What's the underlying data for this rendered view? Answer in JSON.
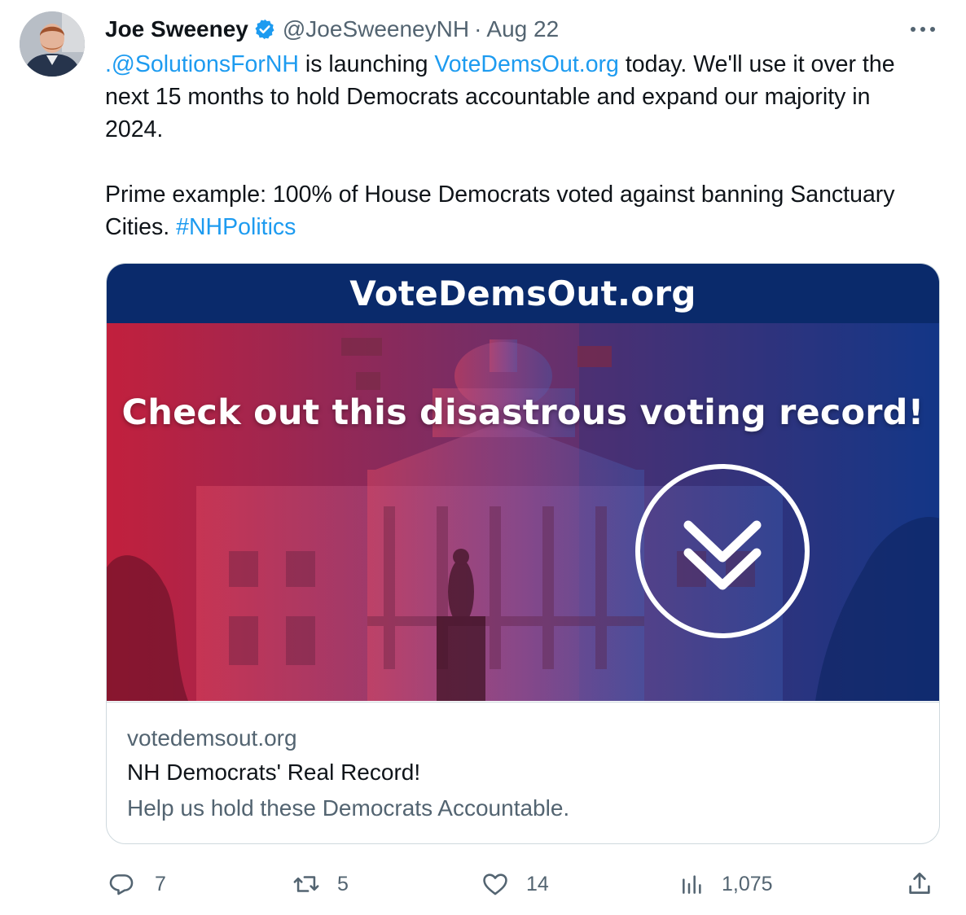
{
  "tweet": {
    "author_name": "Joe Sweeney",
    "handle": "@JoeSweeneyNH",
    "separator": "·",
    "date": "Aug 22",
    "text_mention": ".@SolutionsForNH",
    "text_1": " is launching ",
    "text_link": "VoteDemsOut.org",
    "text_2": " today. We'll use it over the next 15 months to hold Democrats accountable and expand our majority in 2024.",
    "text_3": "Prime example: 100% of House Democrats voted against banning Sanctuary Cities. ",
    "text_hashtag": "#NHPolitics"
  },
  "card": {
    "banner_text": "VoteDemsOut.org",
    "headline": "Check out this disastrous voting record!",
    "domain": "votedemsout.org",
    "title": "NH Democrats' Real Record!",
    "description": "Help us hold these Democrats Accountable."
  },
  "actions": {
    "replies": "7",
    "reposts": "5",
    "likes": "14",
    "views": "1,075"
  },
  "icons": {
    "verified": "verified-badge-icon",
    "more": "more-options-icon",
    "reply": "reply-icon",
    "repost": "repost-icon",
    "like": "heart-icon",
    "views": "views-icon",
    "share": "share-icon",
    "chevron": "double-chevron-down-icon"
  },
  "colors": {
    "link": "#1d9bf0",
    "text": "#0f1419",
    "secondary": "#536471",
    "banner": "#0a2a6b",
    "gradient_red": "#c2203d",
    "gradient_blue": "#14398a"
  }
}
